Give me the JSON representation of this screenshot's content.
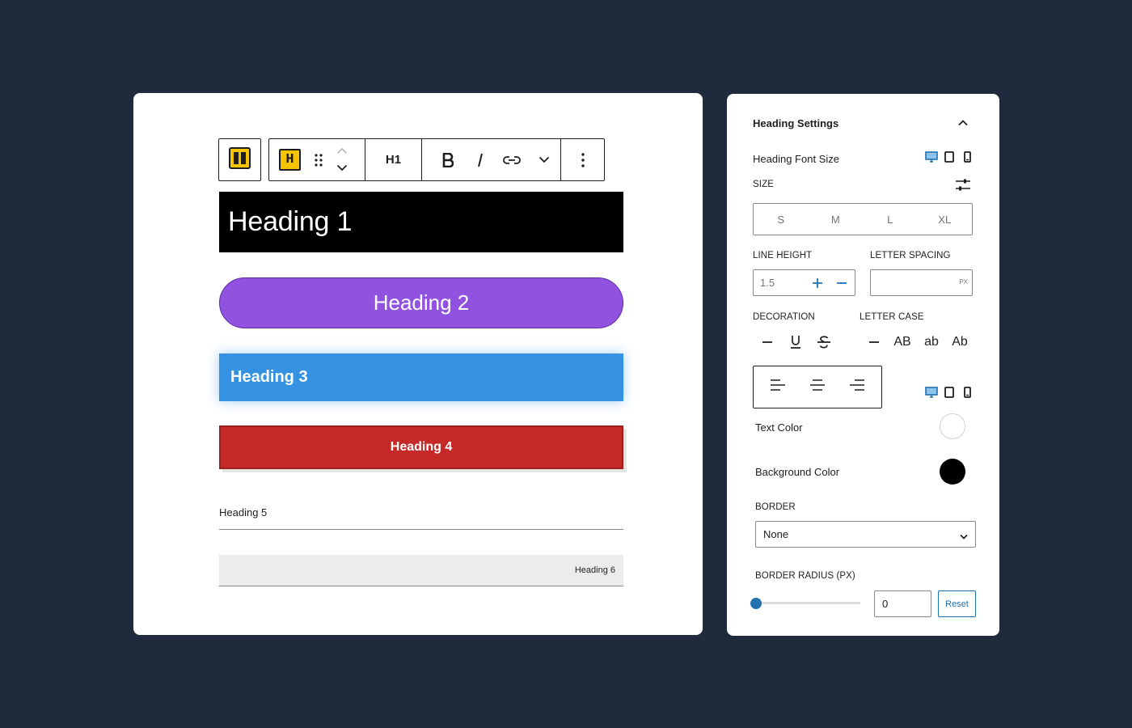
{
  "toolbar": {
    "heading_icon_letter": "H",
    "heading_level": "H1",
    "parent_block_icon": "columns-block-icon",
    "icons": [
      "drag-handle-icon",
      "move-up-icon",
      "move-down-icon",
      "bold-icon",
      "italic-icon",
      "link-icon",
      "more-chevron-icon",
      "options-kebab-icon"
    ]
  },
  "headings": [
    {
      "text": "Heading 1",
      "bg": "#000000",
      "color": "#ffffff"
    },
    {
      "text": "Heading 2",
      "bg": "#9152e0",
      "color": "#ffffff"
    },
    {
      "text": "Heading 3",
      "bg": "#3592e2",
      "color": "#ffffff"
    },
    {
      "text": "Heading 4",
      "bg": "#c52a28",
      "color": "#ffffff"
    },
    {
      "text": "Heading 5",
      "bg": "#ffffff",
      "color": "#1e1e1e"
    },
    {
      "text": "Heading 6",
      "bg": "#ececec",
      "color": "#1e1e1e"
    }
  ],
  "settings": {
    "title": "Heading Settings",
    "font_size_label": "Heading Font Size",
    "size_label": "SIZE",
    "size_options": [
      "S",
      "M",
      "L",
      "XL"
    ],
    "line_height_label": "LINE HEIGHT",
    "line_height_value": "1.5",
    "letter_spacing_label": "LETTER SPACING",
    "letter_spacing_value": "",
    "letter_spacing_unit": "PX",
    "decoration_label": "DECORATION",
    "letter_case_label": "LETTER CASE",
    "letter_case_options": [
      "AB",
      "ab",
      "Ab"
    ],
    "decoration_icons": [
      "none-dash-icon",
      "underline-icon",
      "strikethrough-icon"
    ],
    "alignment_icons": [
      "align-left-icon",
      "align-center-icon",
      "align-right-icon"
    ],
    "device_icons": [
      "desktop-icon",
      "tablet-icon",
      "mobile-icon"
    ],
    "text_color_label": "Text Color",
    "text_color_value": "#ffffff",
    "background_color_label": "Background Color",
    "background_color_value": "#000000",
    "border_label": "BORDER",
    "border_value": "None",
    "border_radius_label": "BORDER RADIUS (PX)",
    "border_radius_value": "0",
    "border_radius_fraction": 0,
    "reset_label": "Reset",
    "accent": "#2271b1"
  }
}
